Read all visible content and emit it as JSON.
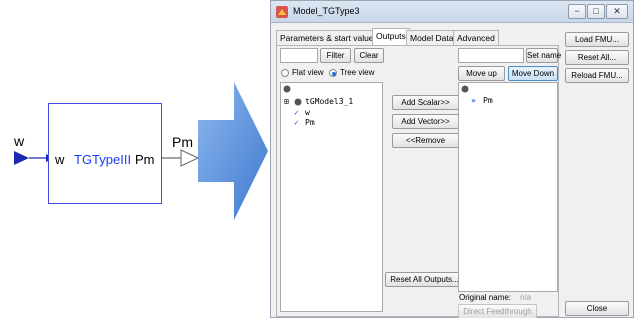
{
  "diagram": {
    "input_label_outer": "w",
    "input_label_inner": "w",
    "block_title": "TGTypeIII",
    "output_label_inner": "Pm",
    "output_label_outer": "Pm"
  },
  "window": {
    "title": "Model_TGType3",
    "tabs": [
      {
        "label": "Parameters & start values",
        "active": false
      },
      {
        "label": "Outputs",
        "active": true
      },
      {
        "label": "Model Data",
        "active": false
      },
      {
        "label": "Advanced",
        "active": false
      }
    ],
    "filter": {
      "value": "",
      "filter_label": "Filter",
      "clear_label": "Clear"
    },
    "view_options": {
      "flat_label": "Flat view",
      "tree_label": "Tree view",
      "selected": "Tree view"
    },
    "tree": {
      "root_name": "tGModel3_1",
      "items": [
        {
          "label": "w",
          "checked": true
        },
        {
          "label": "Pm",
          "checked": true
        }
      ]
    },
    "middle_buttons": {
      "add_scalar": "Add Scalar>>",
      "add_vector": "Add Vector>>",
      "remove": "<<Remove",
      "reset_all": "Reset All Outputs..."
    },
    "right_panel": {
      "name_value": "",
      "set_name_label": "Set name",
      "move_up_label": "Move up",
      "move_down_label": "Move Down",
      "selected_item": "Pm",
      "original_name_label": "Original name:",
      "original_name_value": "n/a",
      "direct_feedthrough_label": "Direct Feedthrough"
    },
    "side_buttons": {
      "load_fmu": "Load FMU...",
      "reset_all": "Reset All...",
      "reload_fmu": "Reload FMU...",
      "close": "Close"
    },
    "accent_color": "#3f7fd4"
  }
}
